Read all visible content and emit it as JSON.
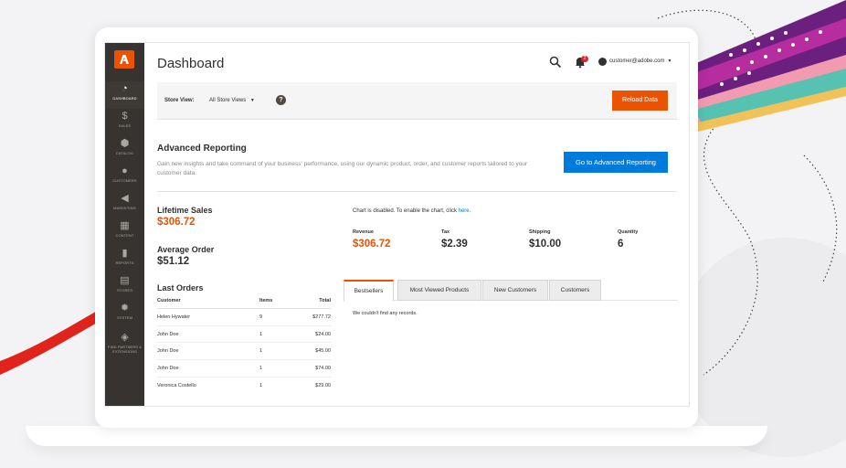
{
  "header": {
    "title": "Dashboard",
    "user_email": "customer@adobe.com",
    "notifications_count": "2"
  },
  "sidebar": {
    "items": [
      {
        "label": "DASHBOARD",
        "icon": "dashboard-icon",
        "active": true
      },
      {
        "label": "SALES",
        "icon": "dollar-icon",
        "active": false
      },
      {
        "label": "CATALOG",
        "icon": "box-icon",
        "active": false
      },
      {
        "label": "CUSTOMERS",
        "icon": "person-icon",
        "active": false
      },
      {
        "label": "MARKETING",
        "icon": "megaphone-icon",
        "active": false
      },
      {
        "label": "CONTENT",
        "icon": "content-icon",
        "active": false
      },
      {
        "label": "REPORTS",
        "icon": "bar-chart-icon",
        "active": false
      },
      {
        "label": "STORES",
        "icon": "store-icon",
        "active": false
      },
      {
        "label": "SYSTEM",
        "icon": "gear-icon",
        "active": false
      },
      {
        "label": "FIND PARTNERS & EXTENSIONS",
        "icon": "cube-icon",
        "active": false
      }
    ]
  },
  "store_view": {
    "label": "Store View:",
    "selected": "All Store Views",
    "reload_label": "Reload Data"
  },
  "advanced_reporting": {
    "title": "Advanced Reporting",
    "description": "Gain new insights and take command of your business' performance, using our dynamic product, order, and customer reports tailored to your customer data.",
    "button_label": "Go to Advanced Reporting"
  },
  "lifetime_sales": {
    "label": "Lifetime Sales",
    "value": "$306.72"
  },
  "average_order": {
    "label": "Average Order",
    "value": "$51.12"
  },
  "last_orders": {
    "title": "Last Orders",
    "columns": [
      "Customer",
      "Items",
      "Total"
    ],
    "rows": [
      {
        "customer": "Helen Hywater",
        "items": "9",
        "total": "$277.72"
      },
      {
        "customer": "John Doe",
        "items": "1",
        "total": "$24.00"
      },
      {
        "customer": "John Doe",
        "items": "1",
        "total": "$45.00"
      },
      {
        "customer": "John Doe",
        "items": "1",
        "total": "$74.00"
      },
      {
        "customer": "Veronica Costello",
        "items": "1",
        "total": "$29.00"
      }
    ]
  },
  "chart": {
    "disabled_text": "Chart is disabled. To enable the chart, click ",
    "link_text": "here."
  },
  "kpis": [
    {
      "label": "Revenue",
      "value": "$306.72"
    },
    {
      "label": "Tax",
      "value": "$2.39"
    },
    {
      "label": "Shipping",
      "value": "$10.00"
    },
    {
      "label": "Quantity",
      "value": "6"
    }
  ],
  "tabs": [
    {
      "label": "Bestsellers",
      "active": true
    },
    {
      "label": "Most Viewed Products",
      "active": false
    },
    {
      "label": "New Customers",
      "active": false
    },
    {
      "label": "Customers",
      "active": false
    }
  ],
  "tab_content": {
    "empty_text": "We couldn't find any records."
  },
  "colors": {
    "accent": "#eb5202",
    "sidebar": "#373330",
    "primary_button": "#007bdb"
  }
}
